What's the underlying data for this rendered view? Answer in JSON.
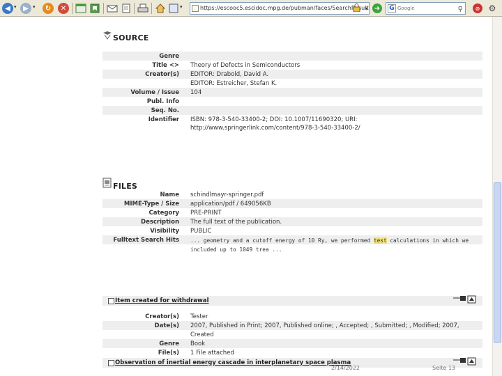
{
  "browser": {
    "url": "https://escooc5.escidoc.mpg.de/pubman/faces/SearchResultLis",
    "search_placeholder": "Google",
    "search_engine_letter": "G"
  },
  "source": {
    "heading": "SOURCE",
    "rows": [
      {
        "label": "Genre",
        "value": ""
      },
      {
        "label": "Title <>",
        "value": "Theory of Defects in Semiconductors"
      },
      {
        "label": "Creator(s)",
        "value": "EDITOR: Drabold, David A.",
        "value2": "EDITOR: Estreicher, Stefan K."
      },
      {
        "label": "Volume / Issue",
        "value": "104"
      },
      {
        "label": "Publ. Info",
        "value": ""
      },
      {
        "label": "Seq. No.",
        "value": ""
      },
      {
        "label": "Identifier",
        "value": "ISBN: 978-3-540-33400-2; DOI: 10.1007/11690320; URI:",
        "value2": "http://www.springerlink.com/content/978-3-540-33400-2/"
      }
    ]
  },
  "files": {
    "heading": "FILES",
    "rows": [
      {
        "label": "Name",
        "value": "schindlmayr-springer.pdf"
      },
      {
        "label": "MIME-Type / Size",
        "value": "application/pdf / 649056KB"
      },
      {
        "label": "Category",
        "value": "PRE-PRINT"
      },
      {
        "label": "Description",
        "value": "The full text of the publication."
      },
      {
        "label": "Visibility",
        "value": "PUBLIC"
      },
      {
        "label": "Fulltext Search Hits",
        "value_before": "... geometry and a cutoff energy of 10 Ry, we performed ",
        "value_hit": "test",
        "value_after": " calculations in which we",
        "value2": "included up to 1049 trea ..."
      }
    ]
  },
  "items": [
    {
      "title": "Item created for withdrawal",
      "rows": [
        {
          "label": "Creator(s)",
          "value": "Tester"
        },
        {
          "label": "Date(s)",
          "value": "2007, Published in Print; 2007, Published online; , Accepted; , Submitted; , Modified; 2007,",
          "value2": "Created"
        },
        {
          "label": "Genre",
          "value": "Book"
        },
        {
          "label": "File(s)",
          "value": "1 File attached"
        }
      ]
    },
    {
      "title": "Observation of inertial energy cascade in interplanetary space plasma"
    }
  ],
  "footer": {
    "date": "2/14/2022",
    "page": "Seite 13"
  }
}
